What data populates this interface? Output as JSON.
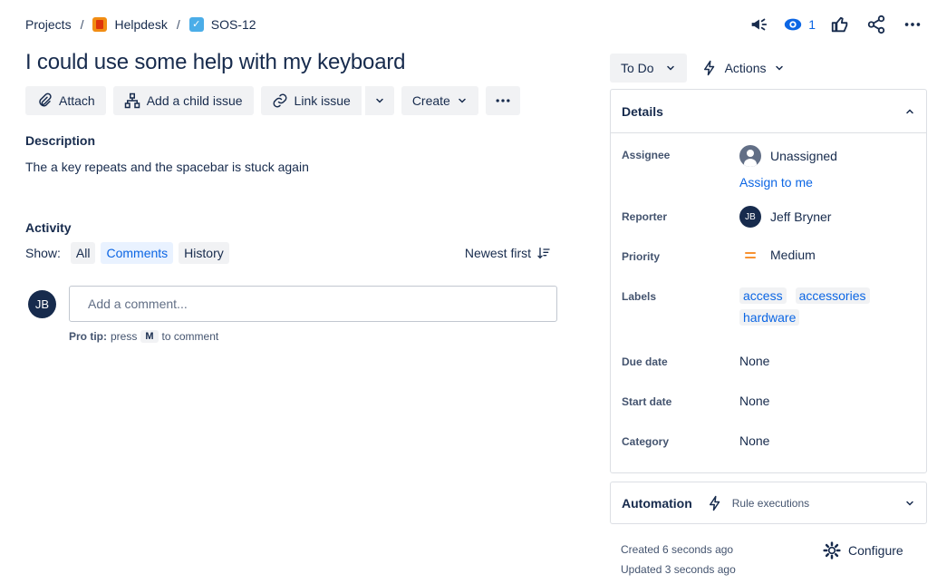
{
  "breadcrumb": {
    "projects": "Projects",
    "project": "Helpdesk",
    "issue_key": "SOS-12"
  },
  "header": {
    "watch_count": "1"
  },
  "issue": {
    "title": "I could use some help with my keyboard"
  },
  "toolbar": {
    "attach": "Attach",
    "add_child": "Add a child issue",
    "link_issue": "Link issue",
    "create": "Create"
  },
  "description": {
    "label": "Description",
    "text": "The a key repeats and the spacebar is stuck again"
  },
  "activity": {
    "label": "Activity",
    "show_label": "Show:",
    "filters": [
      "All",
      "Comments",
      "History"
    ],
    "active_filter": "Comments",
    "sort": "Newest first",
    "comment_placeholder": "Add a comment...",
    "user_initials": "JB",
    "pro_tip_label": "Pro tip:",
    "pro_tip_press": "press",
    "pro_tip_key": "M",
    "pro_tip_suffix": "to comment"
  },
  "status": {
    "current": "To Do",
    "actions": "Actions"
  },
  "details": {
    "title": "Details",
    "assignee_label": "Assignee",
    "assignee_value": "Unassigned",
    "assign_to_me": "Assign to me",
    "reporter_label": "Reporter",
    "reporter_initials": "JB",
    "reporter_value": "Jeff Bryner",
    "priority_label": "Priority",
    "priority_value": "Medium",
    "labels_label": "Labels",
    "labels": [
      "access",
      "accessories",
      "hardware"
    ],
    "due_label": "Due date",
    "due_value": "None",
    "start_label": "Start date",
    "start_value": "None",
    "category_label": "Category",
    "category_value": "None"
  },
  "automation": {
    "title": "Automation",
    "rule": "Rule executions"
  },
  "meta": {
    "created": "Created 6 seconds ago",
    "updated": "Updated 3 seconds ago",
    "configure": "Configure"
  },
  "colors": {
    "link": "#0c66e4",
    "text": "#172b4d",
    "priority_medium": "#f79232",
    "button_bg": "#f1f2f4"
  }
}
